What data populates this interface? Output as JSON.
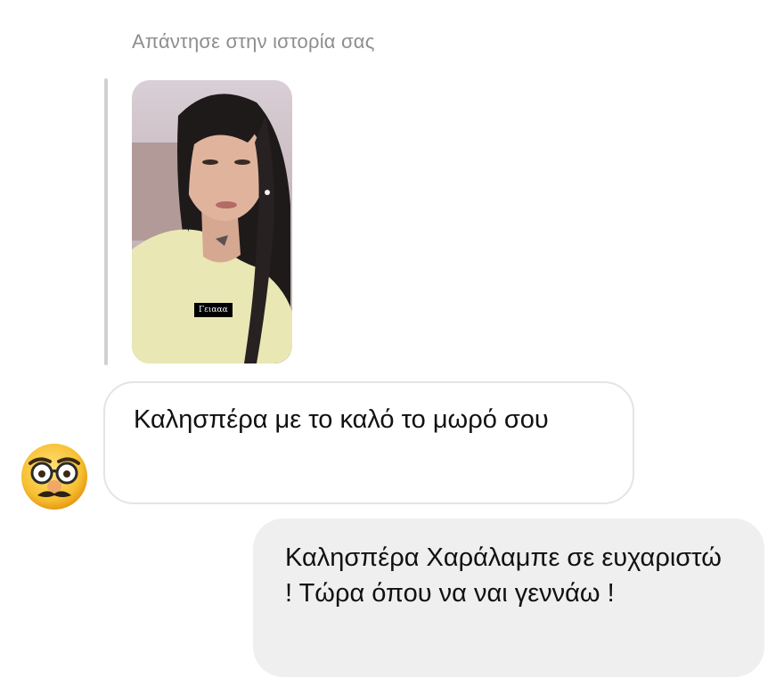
{
  "reply_header": "Απάντησε στην ιστορία σας",
  "story": {
    "caption": "Γειααα"
  },
  "sender_avatar": {
    "icon": "nerd-disguise-emoji-icon"
  },
  "messages": [
    {
      "direction": "incoming",
      "text": "Καλησπέρα με το καλό το μωρό σου"
    },
    {
      "direction": "outgoing",
      "text": "Καλησπέρα Χαράλαμπε σε ευχαριστώ ! Τώρα όπου να ναι γεννάω !"
    }
  ],
  "colors": {
    "outgoing_bubble": "#efefef",
    "incoming_border": "#e4e4e4",
    "secondary_text": "#8e8e8e"
  }
}
